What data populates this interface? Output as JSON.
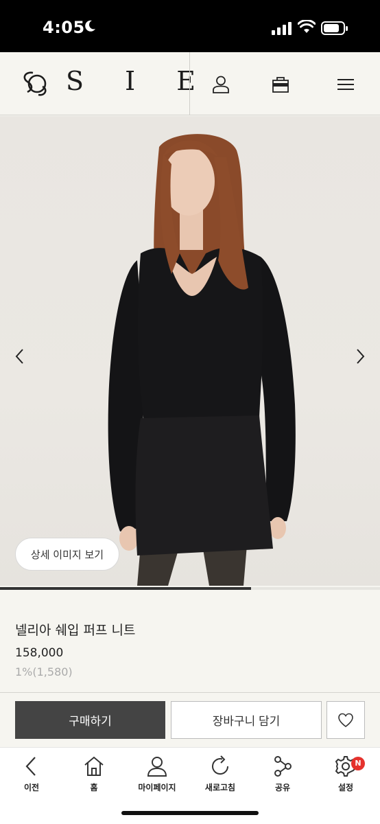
{
  "status_bar": {
    "time": "4:05"
  },
  "header": {
    "brand": "S I E"
  },
  "hero": {
    "detail_button": "상세 이미지 보기",
    "slide_progress": 0.66
  },
  "product": {
    "name": "넬리아 쉐입 퍼프 니트",
    "price": "158,000",
    "points": "1%(1,580)"
  },
  "actions": {
    "buy": "구매하기",
    "cart": "장바구니 담기"
  },
  "nav": {
    "back": "이전",
    "home": "홈",
    "mypage": "마이페이지",
    "refresh": "새로고침",
    "share": "공유",
    "settings": "설정",
    "settings_badge": "N"
  },
  "colors": {
    "primary_button": "#444444",
    "badge": "#e5322d",
    "background": "#f6f5f0"
  }
}
